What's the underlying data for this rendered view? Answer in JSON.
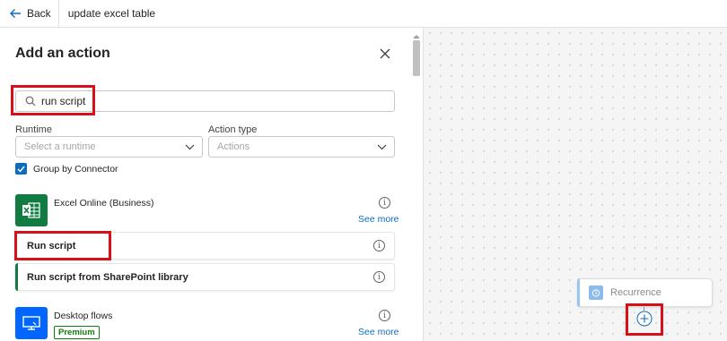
{
  "topbar": {
    "back_label": "Back",
    "flow_name": "update excel table"
  },
  "panel": {
    "title": "Add an action",
    "search": {
      "value": "run script",
      "placeholder": "Search"
    },
    "runtime": {
      "label": "Runtime",
      "placeholder": "Select a runtime"
    },
    "action_type": {
      "label": "Action type",
      "placeholder": "Actions"
    },
    "group_by_connector": {
      "label": "Group by Connector",
      "checked": true
    },
    "connectors": [
      {
        "name": "Excel Online (Business)",
        "icon": "excel-icon",
        "color": "#107c41",
        "see_more": "See more",
        "actions": [
          "Run script",
          "Run script from SharePoint library"
        ]
      },
      {
        "name": "Desktop flows",
        "icon": "desktop-flows-icon",
        "color": "#0066ff",
        "badge": "Premium",
        "see_more": "See more"
      }
    ]
  },
  "canvas": {
    "trigger_label": "Recurrence"
  },
  "colors": {
    "accent": "#0f6cbd",
    "highlight": "#d9101a",
    "excel": "#107c41"
  }
}
